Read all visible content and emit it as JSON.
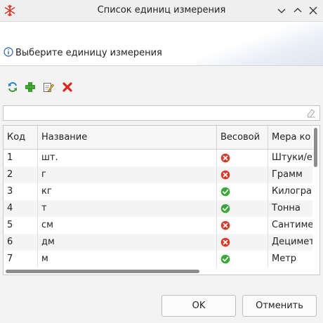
{
  "window": {
    "title": "Список единиц измерения",
    "app_icon": "snowflake-icon",
    "buttons": [
      "minimize-icon",
      "maximize-icon",
      "close-icon"
    ]
  },
  "banner": {
    "icon": "info-icon",
    "message": "Выберите единицу измерения"
  },
  "toolbar": {
    "items": [
      {
        "name": "refresh-icon"
      },
      {
        "name": "add-icon"
      },
      {
        "name": "edit-icon"
      },
      {
        "name": "delete-icon"
      }
    ]
  },
  "search": {
    "value": "",
    "placeholder": "",
    "clear_icon": "eraser-icon"
  },
  "table": {
    "columns": [
      "Код",
      "Название",
      "Весовой",
      "Мера ко"
    ],
    "rows": [
      {
        "code": "1",
        "name": "шт.",
        "weight": false,
        "measure": "Штуки/е"
      },
      {
        "code": "2",
        "name": "г",
        "weight": false,
        "measure": "Грамм"
      },
      {
        "code": "3",
        "name": "кг",
        "weight": true,
        "measure": "Килогра"
      },
      {
        "code": "4",
        "name": "т",
        "weight": true,
        "measure": "Тонна"
      },
      {
        "code": "5",
        "name": "см",
        "weight": false,
        "measure": "Сантиме"
      },
      {
        "code": "6",
        "name": "дм",
        "weight": false,
        "measure": "Децимет"
      },
      {
        "code": "7",
        "name": "м",
        "weight": true,
        "measure": "Метр"
      }
    ]
  },
  "dialog": {
    "ok_label": "OK",
    "cancel_label": "Отменить"
  },
  "colors": {
    "yes": "#3aa63a",
    "no": "#d93a2b",
    "add": "#3cab2e",
    "delete": "#e0261c",
    "refresh": "#2a7fd4"
  }
}
